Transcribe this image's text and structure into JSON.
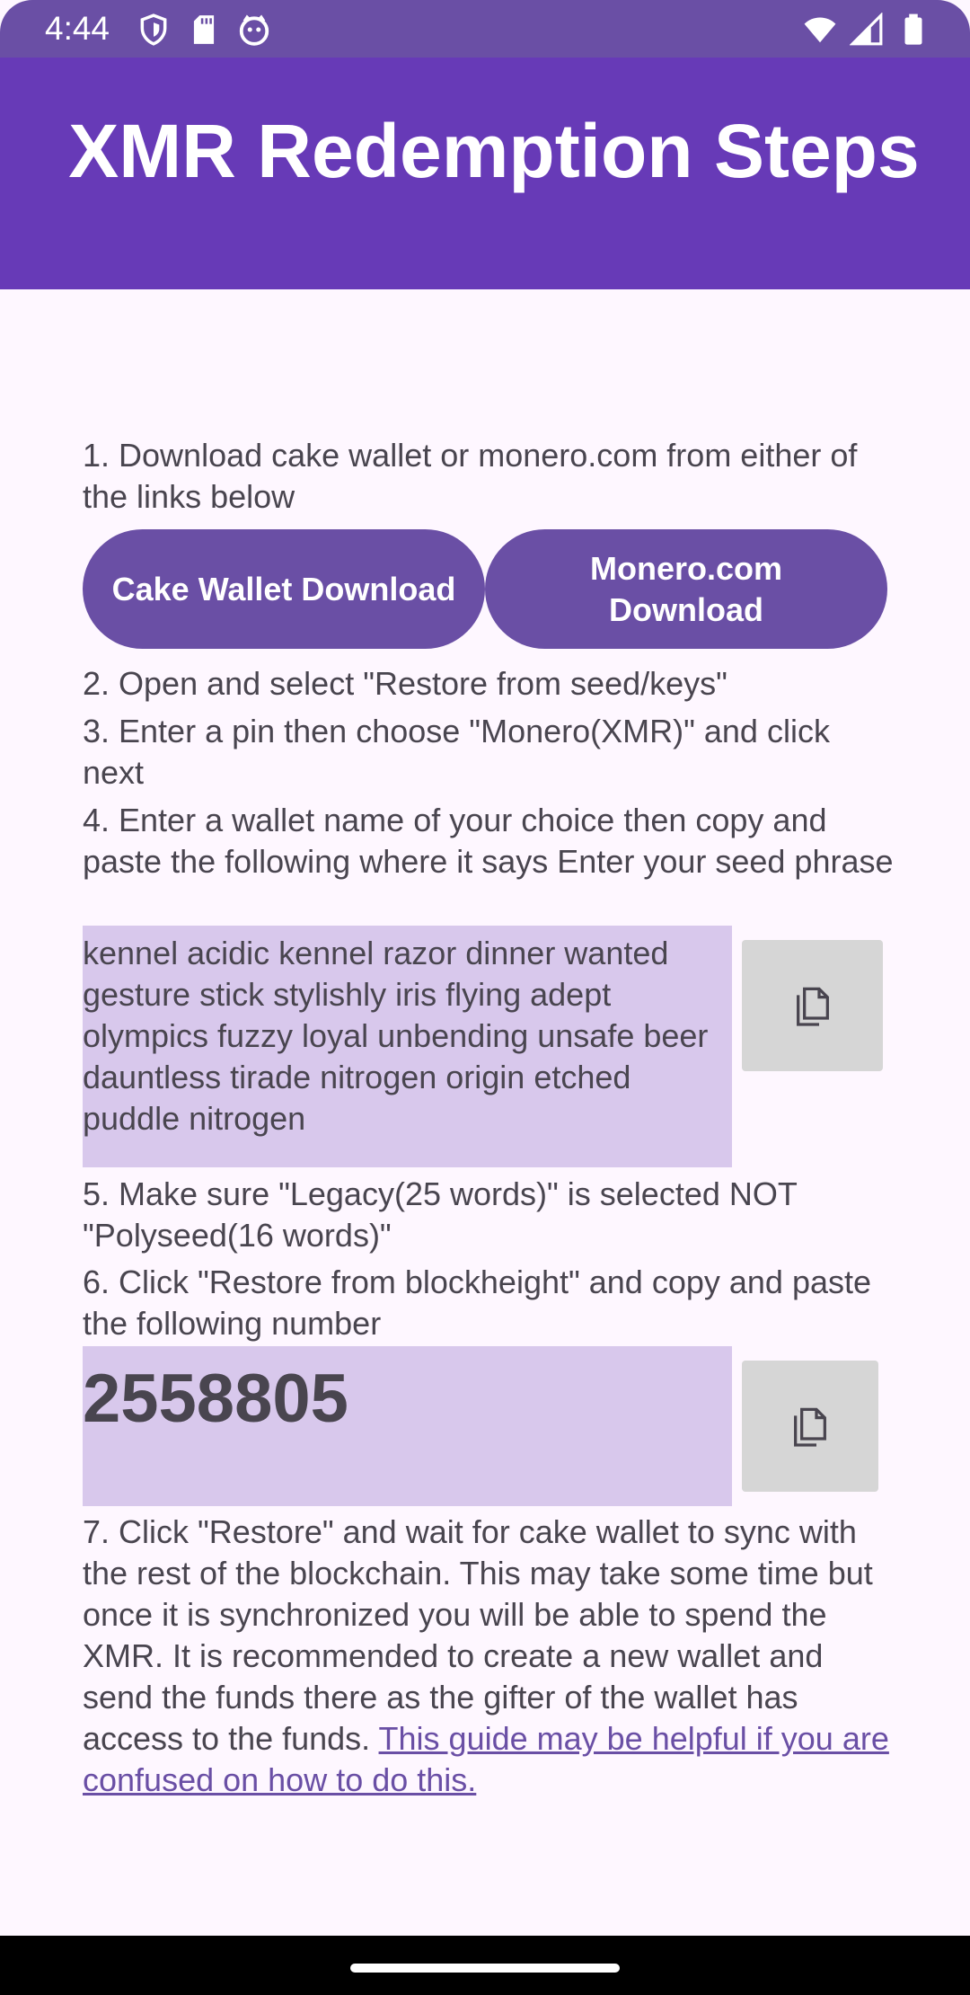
{
  "status_bar": {
    "time": "4:44",
    "left_icons": [
      "shield-icon",
      "sd-card-icon",
      "notification-app-icon"
    ],
    "right_icons": [
      "wifi-icon",
      "signal-icon",
      "battery-icon"
    ]
  },
  "app_bar": {
    "title": "XMR Redemption Steps"
  },
  "steps": {
    "step1": "1. Download cake wallet or monero.com from either of the links below",
    "step2": "2. Open and select \"Restore from seed/keys\"",
    "step3": "3. Enter a pin then choose \"Monero(XMR)\" and click next",
    "step4": "4. Enter a wallet name of your choice then copy and paste the following where it says Enter your seed phrase",
    "step5": "5. Make sure \"Legacy(25 words)\" is selected NOT \"Polyseed(16 words)\"",
    "step6": "6. Click \"Restore from blockheight\" and copy and paste the following number",
    "step7": "7. Click \"Restore\" and wait for cake wallet to sync with the rest of the blockchain. This may take some time but once it is synchronized you will be able to spend the XMR. It is recommended to create a new wallet and send the funds there as the gifter of the wallet has access to the funds. ",
    "step7_link": "This guide may be helpful if you are confused on how to do this."
  },
  "buttons": {
    "cake_wallet": "Cake Wallet Download",
    "monero_com": "Monero.com Download"
  },
  "seed_phrase": "kennel acidic kennel razor dinner wanted gesture stick stylishly iris flying adept olympics fuzzy loyal unbending unsafe beer dauntless tirade nitrogen origin etched puddle nitrogen",
  "block_height": "2558805",
  "colors": {
    "app_bar": "#673AB7",
    "button": "#6A4FA5",
    "highlight_box": "#D8C8EC",
    "background": "#FEF7FF"
  }
}
